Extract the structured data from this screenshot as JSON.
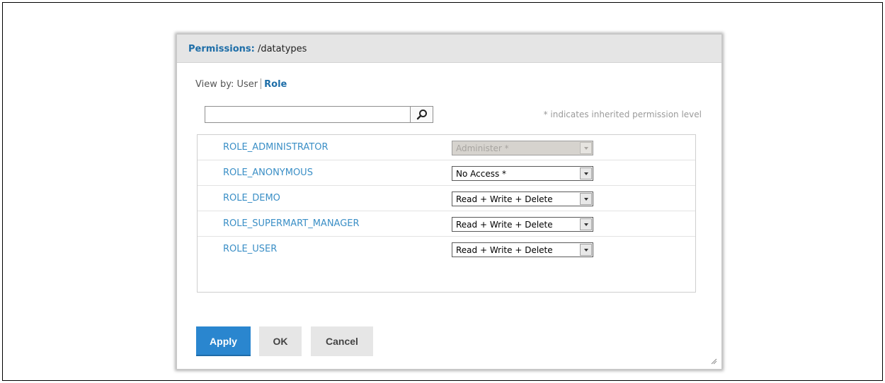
{
  "dialog": {
    "title_prefix": "Permissions:",
    "title_path": "/datatypes"
  },
  "view_by": {
    "label": "View by:",
    "user_label": "User",
    "role_label": "Role",
    "active": "Role"
  },
  "search": {
    "value": "",
    "placeholder": ""
  },
  "hint": "* indicates inherited permission level",
  "roles": [
    {
      "name": "ROLE_ADMINISTRATOR",
      "permission": "Administer *",
      "disabled": true
    },
    {
      "name": "ROLE_ANONYMOUS",
      "permission": "No Access *",
      "disabled": false
    },
    {
      "name": "ROLE_DEMO",
      "permission": "Read + Write + Delete",
      "disabled": false
    },
    {
      "name": "ROLE_SUPERMART_MANAGER",
      "permission": "Read + Write + Delete",
      "disabled": false
    },
    {
      "name": "ROLE_USER",
      "permission": "Read + Write + Delete",
      "disabled": false
    }
  ],
  "buttons": {
    "apply": "Apply",
    "ok": "OK",
    "cancel": "Cancel"
  },
  "colors": {
    "accent": "#1e6ea8",
    "link": "#3b8fc6",
    "apply_bg": "#2a86cf"
  }
}
